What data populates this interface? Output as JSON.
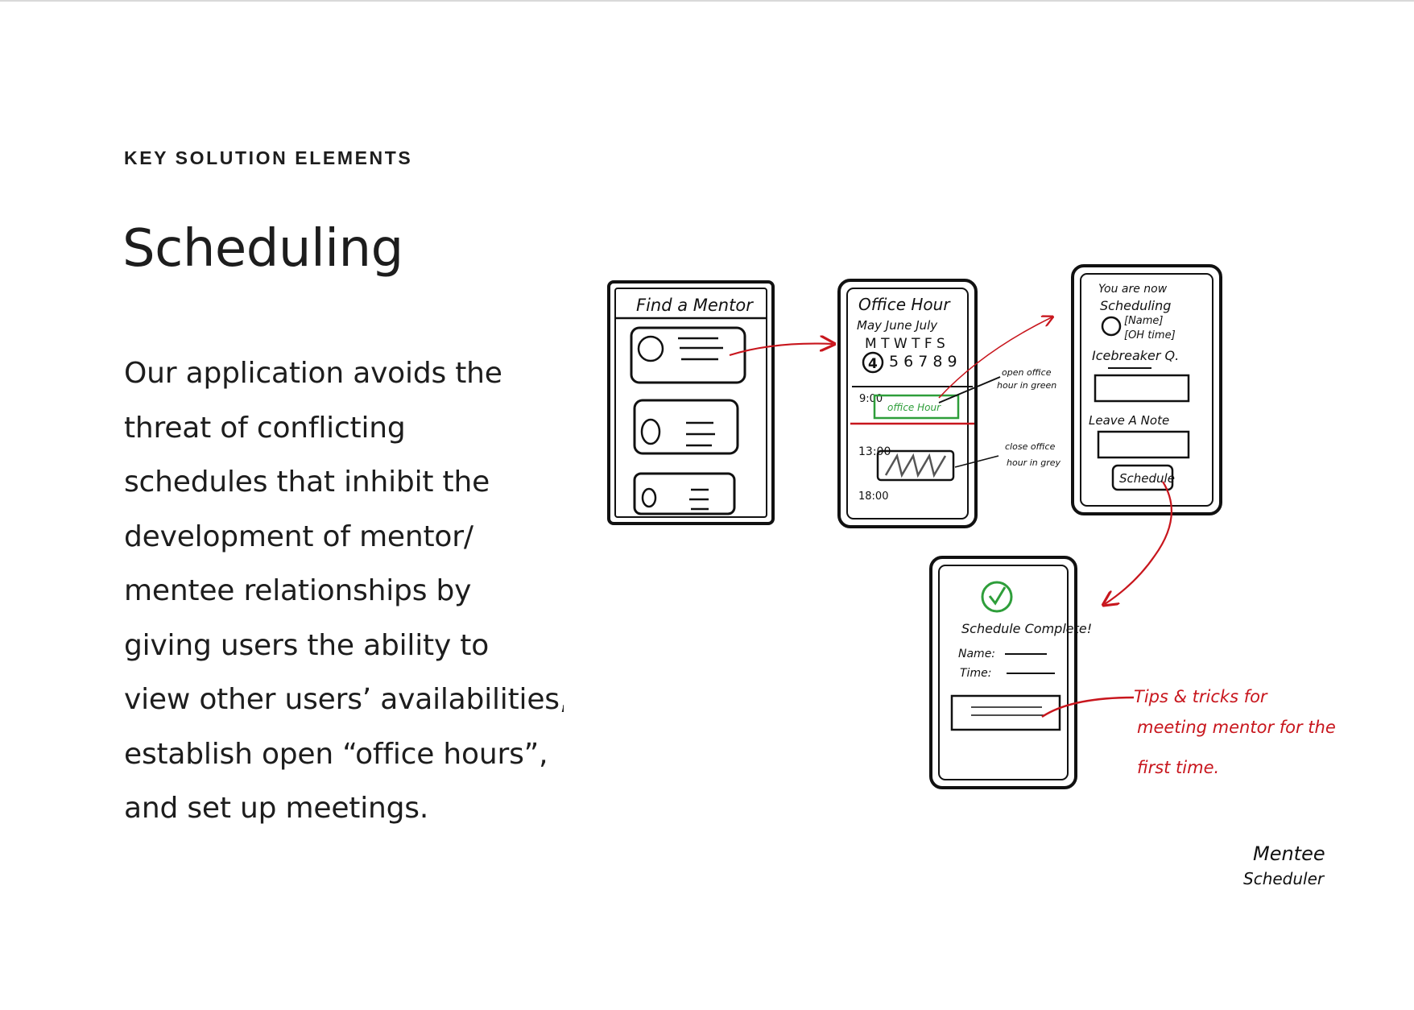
{
  "header": {
    "eyebrow": "KEY SOLUTION ELEMENTS",
    "title": "Scheduling"
  },
  "body": {
    "lines": [
      "Our application avoids the",
      "threat of conflicting",
      "schedules that inhibit the",
      "development of mentor/",
      "mentee relationships by",
      "giving users the ability to",
      "view other users’ availabilities,",
      "establish open “office hours”,",
      "and set up meetings."
    ]
  },
  "sketch": {
    "colors": {
      "ink": "#111111",
      "accent_red": "#c8161d",
      "accent_green": "#2e9e3a",
      "grey": "#555555"
    },
    "screen1": {
      "title": "Find a Mentor"
    },
    "screen2": {
      "title": "Office Hour",
      "months": "May  June  July",
      "weekdays": "M  T  W  T  F  S",
      "dates": "5  6  7  8  9",
      "selected_date": "4",
      "time_1": "9:00",
      "slot_label": "office Hour",
      "time_2": "13:00",
      "time_3": "18:00",
      "note_open_1": "open office",
      "note_open_2": "hour in green",
      "note_close_1": "close office",
      "note_close_2": "hour in grey"
    },
    "screen3": {
      "line1": "You are now",
      "line2": "Scheduling",
      "line3": "[Name]",
      "line4": "[OH time]",
      "icebreaker": "Icebreaker Q.",
      "note": "Leave A Note",
      "button": "Schedule"
    },
    "screen4": {
      "title": "Schedule Complete!",
      "name_label": "Name:",
      "time_label": "Time:"
    },
    "annotation": {
      "line1": "Tips & tricks for",
      "line2": "meeting mentor for the",
      "line3": "first time."
    },
    "signature": {
      "line1": "Mentee",
      "line2": "Scheduler"
    }
  }
}
